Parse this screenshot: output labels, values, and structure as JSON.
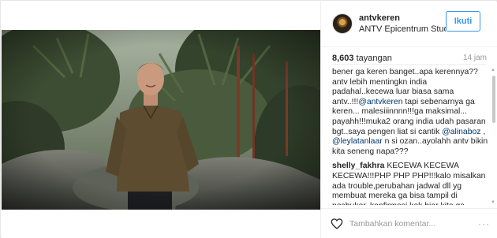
{
  "post": {
    "username": "antvkeren",
    "location": "ANTV Epicentrum Studi...",
    "follow_label": "Ikuti",
    "views_count": "8,603",
    "views_label": "tayangan",
    "time_ago": "14 jam"
  },
  "comments": [
    {
      "author": "",
      "parts": [
        {
          "text": "bener ga keren banget..apa kerennya?? antv lebih mentingkn india padahal..kecewa luar biasa sama antv..!!!"
        },
        {
          "text": "@antvkeren",
          "mention": true
        },
        {
          "text": " tapi sebenarnya ga keren... malesiiinnnn!!!ga maksimal... payahh!!!muka2 orang india udah pasaran bgt..saya pengen liat si cantik "
        },
        {
          "text": "@alinaboz",
          "mention": true
        },
        {
          "text": " , "
        },
        {
          "text": "@leylatanlaar",
          "mention": true
        },
        {
          "text": " n si ozan..ayolahh antv bikin kita seneng napa???"
        }
      ]
    },
    {
      "author": "shelly_fakhra",
      "parts": [
        {
          "text": " KECEWA KECEWA KECEWA!!!PHP PHP PHP!!!kalo misalkan ada trouble,perubahan jadwal dll yg membuat mereka ga bisa tampil di pesbuker..konfirmasi kek biar kita ga"
        }
      ]
    }
  ],
  "footer": {
    "comment_placeholder": "Tambahkan komentar...",
    "more_glyph": "···"
  },
  "colors": {
    "accent": "#3897f0",
    "mention": "#003569"
  },
  "icons": {
    "like": "heart-outline-icon",
    "more": "more-options-icon"
  }
}
